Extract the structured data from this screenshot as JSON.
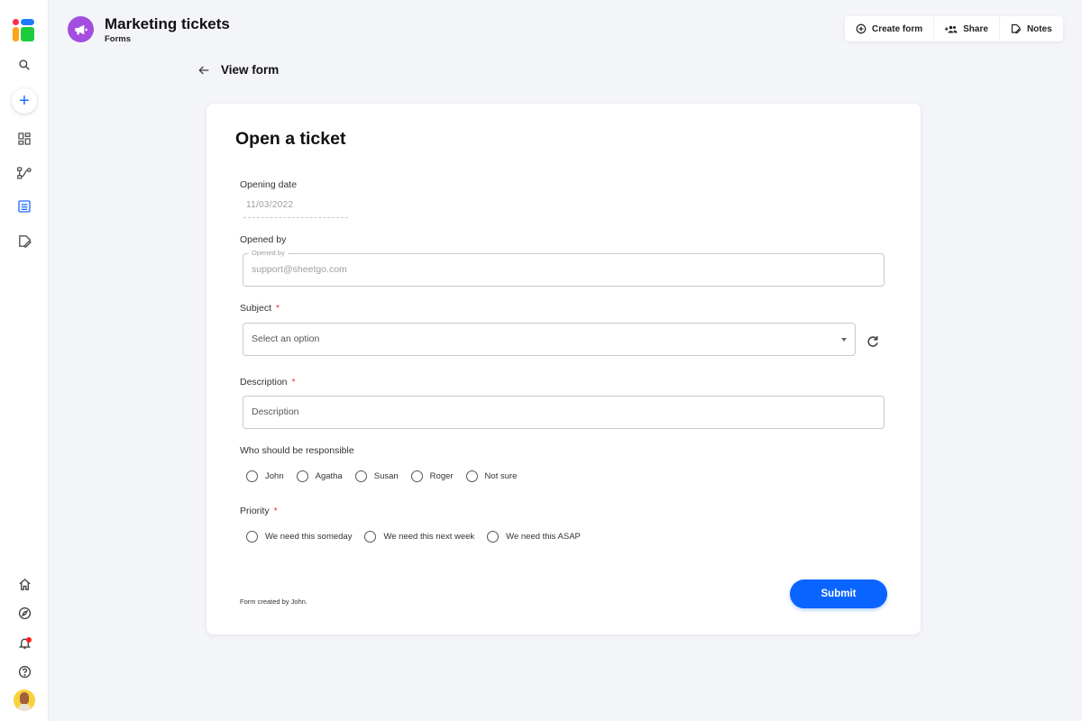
{
  "sidebar": {
    "top_items": [
      {
        "name": "search",
        "icon": "search-icon"
      },
      {
        "name": "create",
        "icon": "plus-icon"
      },
      {
        "name": "dashboard",
        "icon": "dashboard-icon"
      },
      {
        "name": "workflows",
        "icon": "workflow-icon"
      },
      {
        "name": "forms",
        "icon": "form-icon",
        "active": true
      },
      {
        "name": "notes",
        "icon": "edit-note-icon"
      }
    ],
    "bottom_items": [
      {
        "name": "home",
        "icon": "home-icon"
      },
      {
        "name": "explore",
        "icon": "compass-icon"
      },
      {
        "name": "notifications",
        "icon": "bell-icon",
        "has_notification": true
      },
      {
        "name": "help",
        "icon": "help-icon"
      },
      {
        "name": "profile",
        "icon": "avatar"
      }
    ]
  },
  "header": {
    "title": "Marketing tickets",
    "subtitle": "Forms",
    "badge_icon": "megaphone-icon",
    "badge_color": "#a24ee0"
  },
  "toolbar": {
    "create_form": "Create form",
    "share": "Share",
    "notes": "Notes"
  },
  "page": {
    "back_label": "View form"
  },
  "form": {
    "title": "Open a ticket",
    "opening_date": {
      "label": "Opening date",
      "value": "11/03/2022"
    },
    "opened_by": {
      "label": "Opened by",
      "legend": "Opened by",
      "value": "support@sheetgo.com"
    },
    "subject": {
      "label": "Subject",
      "required": "*",
      "placeholder": "Select an option"
    },
    "description": {
      "label": "Description",
      "required": "*",
      "placeholder": "Description"
    },
    "responsible": {
      "label": "Who should be responsible",
      "options": [
        "John",
        "Agatha",
        "Susan",
        "Roger",
        "Not sure"
      ]
    },
    "priority": {
      "label": "Priority",
      "required": "*",
      "options": [
        "We need this someday",
        "We need this next week",
        "We need this ASAP"
      ]
    },
    "footer_note": "Form created by John.",
    "submit_label": "Submit"
  },
  "colors": {
    "accent": "#0a64ff",
    "required": "#e53935",
    "background": "#f4f5f9"
  }
}
